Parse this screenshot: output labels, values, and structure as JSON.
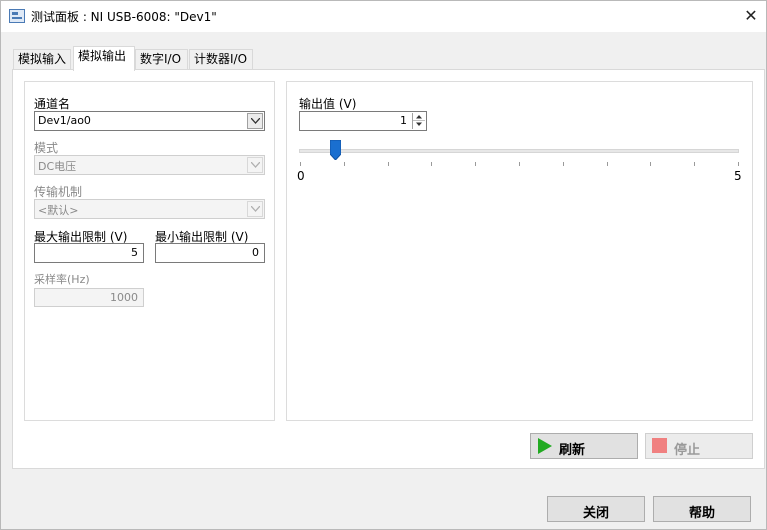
{
  "window": {
    "title": "测试面板 : NI USB-6008: \"Dev1\"",
    "close_label": "✕"
  },
  "tabs": [
    {
      "label": "模拟输入",
      "active": false
    },
    {
      "label": "模拟输出",
      "active": true
    },
    {
      "label": "数字I/O",
      "active": false
    },
    {
      "label": "计数器I/O",
      "active": false
    }
  ],
  "left_panel": {
    "channel_label": "通道名",
    "channel_value": "Dev1/ao0",
    "mode_label": "模式",
    "mode_value": "DC电压",
    "transfer_label": "传输机制",
    "transfer_value": "<默认>",
    "max_label": "最大输出限制 (V)",
    "max_value": "5",
    "min_label": "最小输出限制 (V)",
    "min_value": "0",
    "rate_label": "采样率(Hz)",
    "rate_value": "1000"
  },
  "right_panel": {
    "output_label": "输出值 (V)",
    "output_value": "1",
    "slider": {
      "min": 0,
      "max": 5,
      "value": 1,
      "min_label": "0",
      "max_label": "5",
      "tick_count": 11
    }
  },
  "buttons": {
    "refresh_label": "刷新",
    "stop_label": "停止",
    "close_label": "关闭",
    "help_label": "帮助"
  },
  "colors": {
    "refresh_icon": "#22aa22",
    "stop_icon": "#f08080",
    "slider_thumb": "#1a6fd0"
  }
}
